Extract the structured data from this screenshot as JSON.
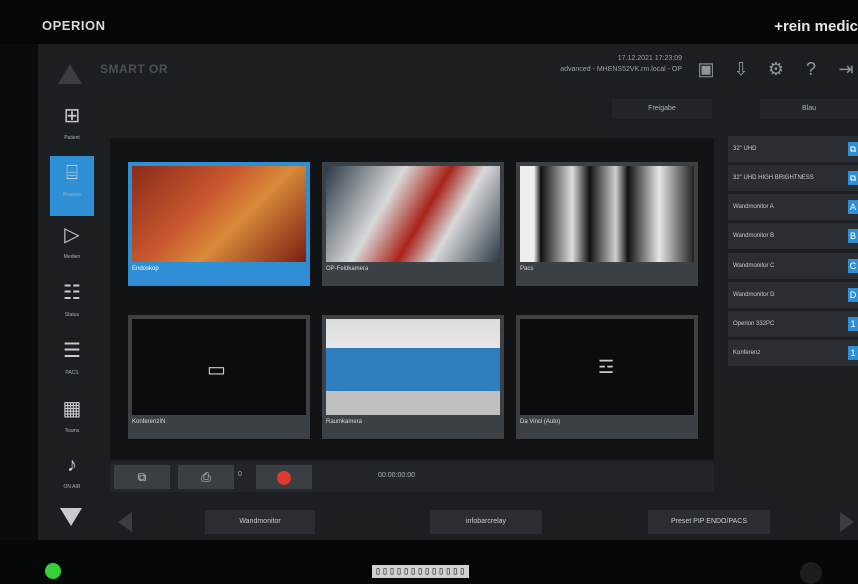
{
  "device": {
    "brand_left": "OPERION",
    "brand_right": "+rein medic",
    "power_led_color": "#36d13a",
    "label": "▯▯▯▯▯▯▯▯▯▯▯▯▯"
  },
  "topbar": {
    "logo_text": "SMART OR",
    "datetime": "17.12.2021 17:23:09",
    "host": "advanced - MHENS52VK.rm.local - OP",
    "icons": [
      "usb-icon",
      "download-icon",
      "gear-icon",
      "help-icon",
      "logout-icon"
    ]
  },
  "subbar": {
    "freigabe": "Freigabe",
    "blau": "Blau"
  },
  "sidebar": {
    "items": [
      {
        "label": "Patient",
        "icon": "patient-icon"
      },
      {
        "label": "Prozess",
        "icon": "process-icon",
        "active": true
      },
      {
        "label": "Medien",
        "icon": "media-icon"
      },
      {
        "label": "Status",
        "icon": "checklist-icon"
      },
      {
        "label": "PACS",
        "icon": "xray-icon"
      },
      {
        "label": "Teams",
        "icon": "teams-icon"
      },
      {
        "label": "ON AIR",
        "icon": "on-air-icon"
      }
    ]
  },
  "tiles": [
    {
      "caption": "Endoskop",
      "selected": true
    },
    {
      "caption": "OP-Feldkamera"
    },
    {
      "caption": "Pacs"
    },
    {
      "caption": "KonferenzIN"
    },
    {
      "caption": "Raumkamera"
    },
    {
      "caption": "Da Vinci (Auto)"
    }
  ],
  "controls": {
    "snapshot_count": "0",
    "timecode": "00:00:00:00",
    "record_color": "#e03a2c"
  },
  "monitors": [
    {
      "label": "32\" UHD",
      "badge": ""
    },
    {
      "label": "32\" UHD HIGH BRIGHTNESS",
      "badge": ""
    },
    {
      "label": "Wandmonitor A",
      "badge": "A"
    },
    {
      "label": "Wandmonitor B",
      "badge": "B"
    },
    {
      "label": "Wandmonitor C",
      "badge": "C"
    },
    {
      "label": "Wandmonitor D",
      "badge": "D"
    },
    {
      "label": "Operion 332PC",
      "badge": "1"
    },
    {
      "label": "Konferenz",
      "badge": "1"
    }
  ],
  "footer": {
    "btn1": "Wandmonitor",
    "btn2": "infobarcrelay",
    "btn3": "Preset PIP ENDO/PACS"
  },
  "colors": {
    "accent": "#2f8fd4",
    "background": "#1c1f22"
  }
}
